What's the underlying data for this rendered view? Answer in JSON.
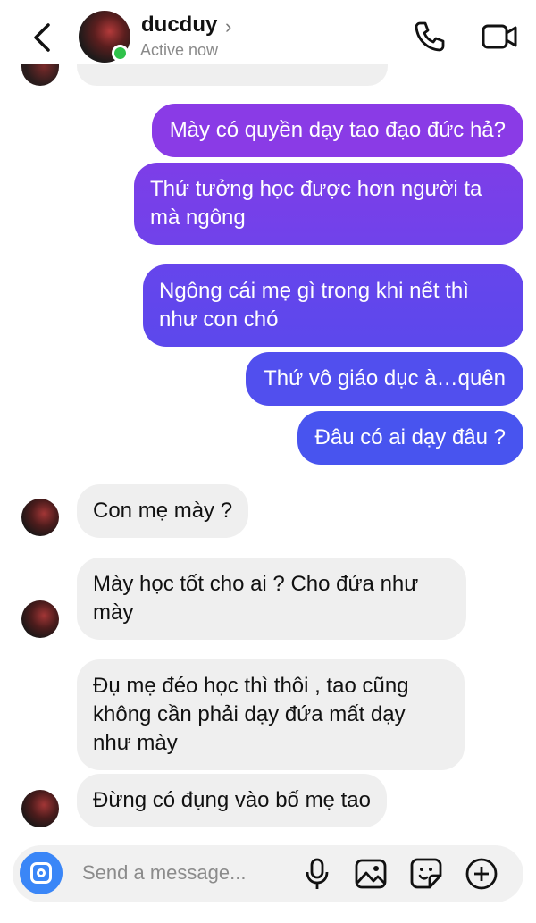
{
  "header": {
    "username": "ducduy",
    "chevron": "›",
    "status": "Active now"
  },
  "messages": {
    "out": [
      "Mày có quyền dạy tao đạo đức hả?",
      "Thứ tưởng học được hơn người ta",
      "mà ngông",
      "Ngông cái mẹ gì trong khi nết thì",
      "như con chó",
      "Thứ vô giáo dục à…quên",
      "Đâu có ai dạy đâu ?"
    ],
    "in": [
      "Con mẹ mày ?",
      "Mày học tốt cho ai ? Cho đứa như",
      "mày",
      "Đụ mẹ đéo học thì thôi , tao cũng",
      "không cần phải dạy đứa mất dạy",
      "như mày",
      "Đừng có đụng vào bố mẹ tao"
    ]
  },
  "composer": {
    "placeholder": "Send a message..."
  },
  "icons": [
    "back-icon",
    "phone-icon",
    "video-icon",
    "camera-icon",
    "microphone-icon",
    "image-icon",
    "sticker-icon",
    "plus-icon"
  ],
  "colors": {
    "out_top": "#8b3ae6",
    "out_bottom": "#4453ef",
    "incoming": "#efefef",
    "online": "#2fc24a",
    "camera": "#3a86f7"
  }
}
